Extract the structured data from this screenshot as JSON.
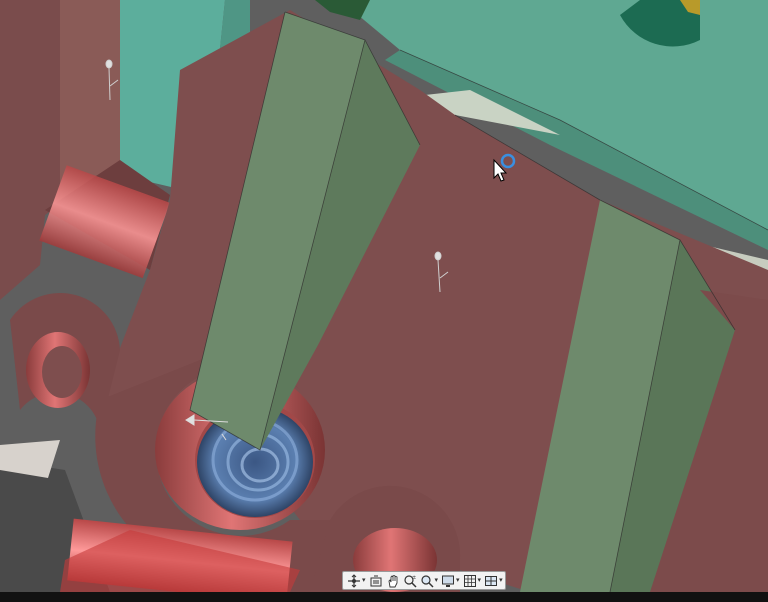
{
  "app": {
    "view": "3d-viewport"
  },
  "navigation_bar": {
    "tools": [
      {
        "id": "orbit",
        "icon": "orbit-icon",
        "has_dropdown": true
      },
      {
        "id": "look-at",
        "icon": "look-at-icon",
        "has_dropdown": false
      },
      {
        "id": "pan",
        "icon": "pan-hand-icon",
        "has_dropdown": false
      },
      {
        "id": "zoom-window",
        "icon": "zoom-window-icon",
        "has_dropdown": false
      },
      {
        "id": "fit",
        "icon": "zoom-fit-icon",
        "has_dropdown": true
      },
      {
        "id": "display",
        "icon": "display-settings-icon",
        "has_dropdown": true
      },
      {
        "id": "grid",
        "icon": "grid-icon",
        "has_dropdown": true
      },
      {
        "id": "viewports",
        "icon": "multiple-views-icon",
        "has_dropdown": true
      }
    ]
  },
  "colors": {
    "body_red": "#7e4e4e",
    "rib_green": "#6e8a6c",
    "teal_part": "#5fa892",
    "hole_red": "#c25b5b",
    "spring_blue": "#4f6f9c",
    "cursor_ring": "#3a8fe0"
  }
}
